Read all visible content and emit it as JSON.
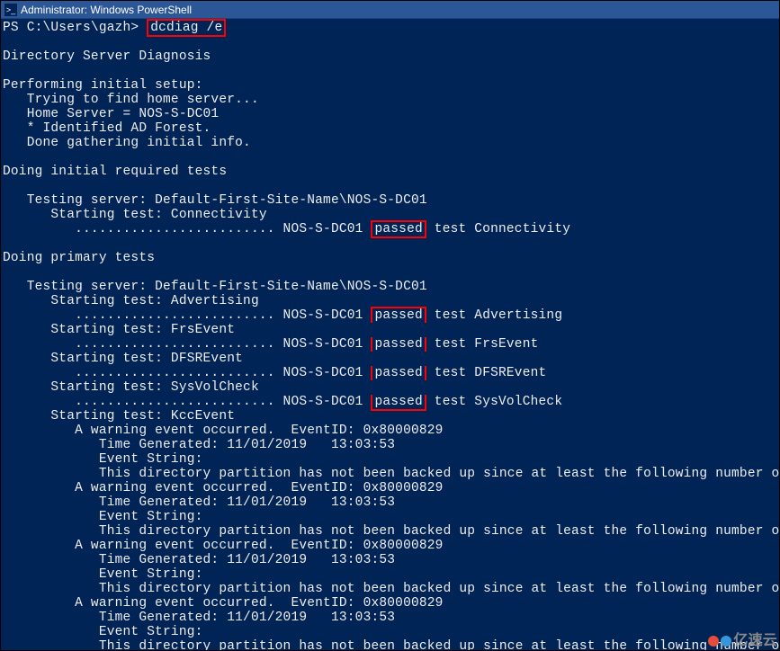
{
  "window": {
    "title": "Administrator: Windows PowerShell"
  },
  "prompt": "PS C:\\Users\\gazh>",
  "command": "dcdiag /e",
  "output": {
    "header": "Directory Server Diagnosis",
    "setup_header": "Performing initial setup:",
    "setup_lines": [
      "   Trying to find home server...",
      "   Home Server = NOS-S-DC01",
      "   * Identified AD Forest.",
      "   Done gathering initial info."
    ],
    "initial_tests_header": "Doing initial required tests",
    "testing_server_line": "   Testing server: Default-First-Site-Name\\NOS-S-DC01",
    "starting_connectivity": "      Starting test: Connectivity",
    "connectivity_prefix": "         ......................... NOS-S-DC01 ",
    "passed": "passed",
    "connectivity_suffix": " test Connectivity",
    "primary_tests_header": "Doing primary tests",
    "starting_advertising": "      Starting test: Advertising",
    "advertising_prefix": "         ......................... NOS-S-DC01 ",
    "advertising_suffix": " test Advertising",
    "starting_frsevent": "      Starting test: FrsEvent",
    "frsevent_prefix": "         ......................... NOS-S-DC01 ",
    "frsevent_suffix": " test FrsEvent",
    "starting_dfsrevent": "      Starting test: DFSREvent",
    "dfsrevent_prefix": "         ......................... NOS-S-DC01 ",
    "dfsrevent_suffix": " test DFSREvent",
    "starting_sysvolcheck": "      Starting test: SysVolCheck",
    "sysvolcheck_prefix": "         ......................... NOS-S-DC01 ",
    "sysvolcheck_suffix": " test SysVolCheck",
    "starting_kccevent": "      Starting test: KccEvent",
    "warning_event": "         A warning event occurred.  EventID: 0x80000829",
    "time_generated": "            Time Generated: 11/01/2019   13:03:53",
    "event_string": "            Event String:",
    "backup_msg": "            This directory partition has not been backed up since at least the following number of days."
  },
  "watermark": "亿速云",
  "highlight_color": "#ff0000"
}
